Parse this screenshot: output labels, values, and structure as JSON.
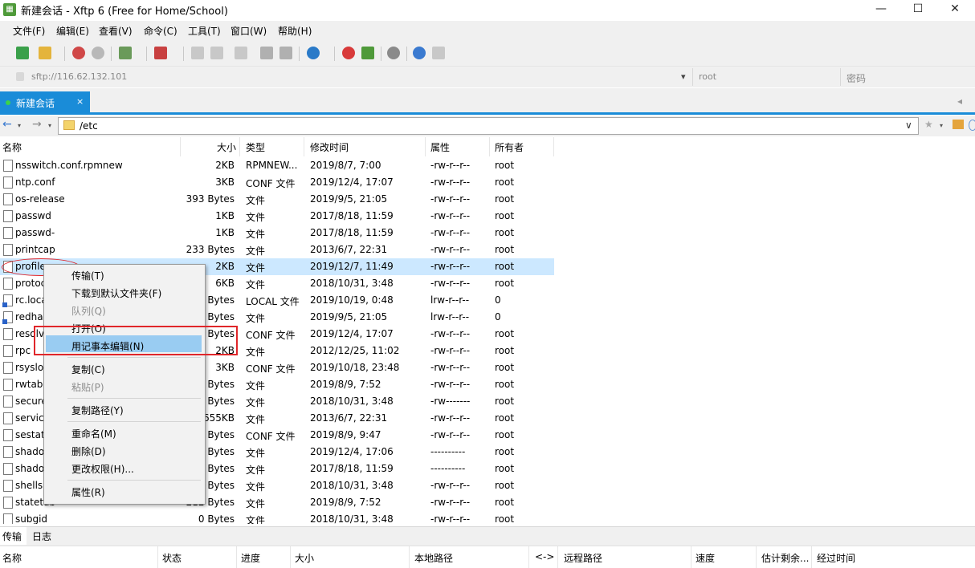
{
  "window": {
    "title": "新建会话 - Xftp 6 (Free for Home/School)",
    "app_icon": "xftp-icon",
    "min": "—",
    "max": "☐",
    "close": "✕"
  },
  "menu": [
    "文件(F)",
    "编辑(E)",
    "查看(V)",
    "命令(C)",
    "工具(T)",
    "窗口(W)",
    "帮助(H)"
  ],
  "address": {
    "url": "sftp://116.62.132.101",
    "user_placeholder": "root",
    "password_placeholder": "密码",
    "dropdown": "▾"
  },
  "tab": {
    "label": "新建会话",
    "close": "×",
    "scroll_left": "◂"
  },
  "path": {
    "value": "/etc",
    "dropdown": "∨"
  },
  "columns": [
    "名称",
    "大小",
    "类型",
    "修改时间",
    "属性",
    "所有者"
  ],
  "files": [
    {
      "name": "nsswitch.conf.rpmnew",
      "size": "2KB",
      "type": "RPMNEW...",
      "mtime": "2019/8/7, 7:00",
      "attr": "-rw-r--r--",
      "owner": "root"
    },
    {
      "name": "ntp.conf",
      "size": "3KB",
      "type": "CONF 文件",
      "mtime": "2019/12/4, 17:07",
      "attr": "-rw-r--r--",
      "owner": "root"
    },
    {
      "name": "os-release",
      "size": "393 Bytes",
      "type": "文件",
      "mtime": "2019/9/5, 21:05",
      "attr": "-rw-r--r--",
      "owner": "root"
    },
    {
      "name": "passwd",
      "size": "1KB",
      "type": "文件",
      "mtime": "2017/8/18, 11:59",
      "attr": "-rw-r--r--",
      "owner": "root"
    },
    {
      "name": "passwd-",
      "size": "1KB",
      "type": "文件",
      "mtime": "2017/8/18, 11:59",
      "attr": "-rw-r--r--",
      "owner": "root"
    },
    {
      "name": "printcap",
      "size": "233 Bytes",
      "type": "文件",
      "mtime": "2013/6/7, 22:31",
      "attr": "-rw-r--r--",
      "owner": "root"
    },
    {
      "name": "profile",
      "size": "2KB",
      "type": "文件",
      "mtime": "2019/12/7, 11:49",
      "attr": "-rw-r--r--",
      "owner": "root"
    },
    {
      "name": "protoc",
      "size": "6KB",
      "type": "文件",
      "mtime": "2018/10/31, 3:48",
      "attr": "-rw-r--r--",
      "owner": "root"
    },
    {
      "name": "rc.loca",
      "size": "3 Bytes",
      "type": "LOCAL 文件",
      "mtime": "2019/10/19, 0:48",
      "attr": "lrw-r--r--",
      "owner": "0"
    },
    {
      "name": "redhat",
      "size": "7 Bytes",
      "type": "文件",
      "mtime": "2019/9/5, 21:05",
      "attr": "lrw-r--r--",
      "owner": "0"
    },
    {
      "name": "resolv",
      "size": "3 Bytes",
      "type": "CONF 文件",
      "mtime": "2019/12/4, 17:07",
      "attr": "-rw-r--r--",
      "owner": "root"
    },
    {
      "name": "rpc",
      "size": "2KB",
      "type": "文件",
      "mtime": "2012/12/25, 11:02",
      "attr": "-rw-r--r--",
      "owner": "root"
    },
    {
      "name": "rsyslo",
      "size": "3KB",
      "type": "CONF 文件",
      "mtime": "2019/10/18, 23:48",
      "attr": "-rw-r--r--",
      "owner": "root"
    },
    {
      "name": "rwtab",
      "size": "5 Bytes",
      "type": "文件",
      "mtime": "2019/8/9, 7:52",
      "attr": "-rw-r--r--",
      "owner": "root"
    },
    {
      "name": "secure",
      "size": "5 Bytes",
      "type": "文件",
      "mtime": "2018/10/31, 3:48",
      "attr": "-rw-------",
      "owner": "root"
    },
    {
      "name": "service",
      "size": "655KB",
      "type": "文件",
      "mtime": "2013/6/7, 22:31",
      "attr": "-rw-r--r--",
      "owner": "root"
    },
    {
      "name": "sestat",
      "size": "5 Bytes",
      "type": "CONF 文件",
      "mtime": "2019/8/9, 9:47",
      "attr": "-rw-r--r--",
      "owner": "root"
    },
    {
      "name": "shado",
      "size": "1 Bytes",
      "type": "文件",
      "mtime": "2019/12/4, 17:06",
      "attr": "----------",
      "owner": "root"
    },
    {
      "name": "shado",
      "size": "9 Bytes",
      "type": "文件",
      "mtime": "2017/8/18, 11:59",
      "attr": "----------",
      "owner": "root"
    },
    {
      "name": "shells",
      "size": "4 Bytes",
      "type": "文件",
      "mtime": "2018/10/31, 3:48",
      "attr": "-rw-r--r--",
      "owner": "root"
    },
    {
      "name": "statetab",
      "size": "212 Bytes",
      "type": "文件",
      "mtime": "2019/8/9, 7:52",
      "attr": "-rw-r--r--",
      "owner": "root"
    },
    {
      "name": "subgid",
      "size": "0 Bytes",
      "type": "文件",
      "mtime": "2018/10/31, 3:48",
      "attr": "-rw-r--r--",
      "owner": "root"
    }
  ],
  "context_menu": [
    {
      "label": "传输(T)",
      "disabled": false
    },
    {
      "label": "下载到默认文件夹(F)",
      "disabled": false
    },
    {
      "label": "队列(Q)",
      "disabled": true
    },
    {
      "label": "打开(O)",
      "disabled": false
    },
    {
      "label": "用记事本编辑(N)",
      "disabled": false
    },
    {
      "label": "复制(C)",
      "disabled": false
    },
    {
      "label": "粘贴(P)",
      "disabled": true
    },
    {
      "label": "复制路径(Y)",
      "disabled": false
    },
    {
      "label": "重命名(M)",
      "disabled": false
    },
    {
      "label": "删除(D)",
      "disabled": false
    },
    {
      "label": "更改权限(H)...",
      "disabled": false
    },
    {
      "label": "属性(R)",
      "disabled": false
    }
  ],
  "bottom_tabs": [
    "传输",
    "日志"
  ],
  "transfer_columns": [
    "名称",
    "状态",
    "进度",
    "大小",
    "本地路径",
    "<->",
    "远程路径",
    "速度",
    "估计剩余...",
    "经过时间"
  ],
  "accent_color": "#1a8cd8",
  "highlight_color": "#e0262a"
}
